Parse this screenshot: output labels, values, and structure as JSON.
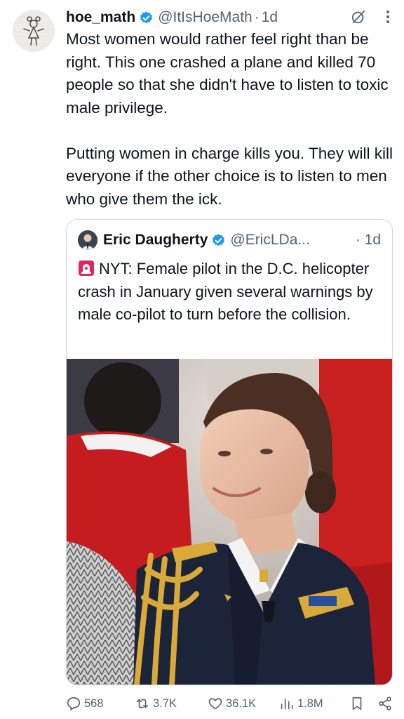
{
  "tweet": {
    "author_name": "hoe_math",
    "author_handle": "@ItIsHoeMath",
    "separator": "·",
    "time": "1d",
    "text": "Most women would rather feel right than be right. This one crashed a plane and killed 70 people so that she didn't have to listen to toxic male privilege.\n\nPutting women in charge kills you. They will kill everyone if the other choice is to listen to men who give them the ick."
  },
  "quote": {
    "author_name": "Eric Daugherty",
    "author_handle": "@EricLDa...",
    "time": "· 1d",
    "text": "NYT: Female pilot in the D.C. helicopter crash in January given several warnings by male co-pilot to turn before the collision."
  },
  "actions": {
    "replies": "568",
    "reposts": "3.7K",
    "likes": "36.1K",
    "views": "1.8M"
  },
  "icons": {
    "verified": "verified-badge-icon",
    "grok": "grok-icon",
    "more": "more-icon",
    "siren": "police-light-emoji",
    "reply": "reply-icon",
    "repost": "repost-icon",
    "like": "heart-icon",
    "views": "views-icon",
    "bookmark": "bookmark-icon",
    "share": "share-icon"
  },
  "colors": {
    "accent": "#1d9bf0",
    "text": "#0f1419",
    "muted": "#536471",
    "border": "#cfd9de"
  }
}
